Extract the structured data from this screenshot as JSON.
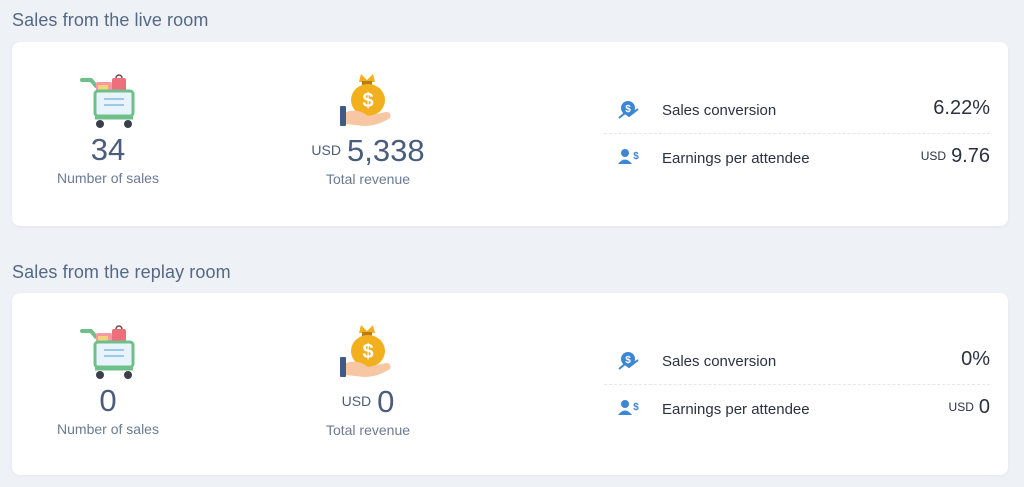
{
  "live": {
    "title": "Sales from the live room",
    "sales_count": "34",
    "sales_label": "Number of sales",
    "revenue_currency": "USD",
    "revenue_value": "5,338",
    "revenue_label": "Total revenue",
    "conversion_label": "Sales conversion",
    "conversion_value": "6.22%",
    "earnings_label": "Earnings per attendee",
    "earnings_currency": "USD",
    "earnings_value": "9.76"
  },
  "replay": {
    "title": "Sales from the replay room",
    "sales_count": "0",
    "sales_label": "Number of sales",
    "revenue_currency": "USD",
    "revenue_value": "0",
    "revenue_label": "Total revenue",
    "conversion_label": "Sales conversion",
    "conversion_value": "0%",
    "earnings_label": "Earnings per attendee",
    "earnings_currency": "USD",
    "earnings_value": "0"
  },
  "icons": {
    "cart": "shopping-cart-icon",
    "revenue": "money-bag-hand-icon",
    "conversion": "dollar-chart-icon",
    "earnings": "user-dollar-icon"
  },
  "colors": {
    "background": "#eef1f6",
    "card": "#ffffff",
    "accent": "#3d86d6",
    "gold": "#f2b01e"
  }
}
